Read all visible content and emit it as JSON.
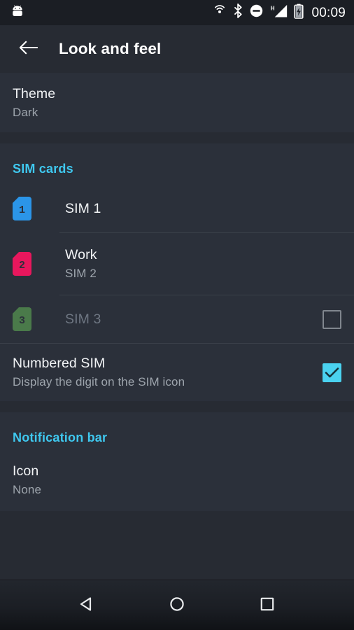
{
  "status_bar": {
    "notification_icon": "android-head-icon",
    "icons": [
      "cast-icon",
      "bluetooth-icon",
      "do-not-disturb-icon",
      "hspa-signal-icon",
      "battery-charging-icon"
    ],
    "clock": "00:09"
  },
  "app_bar": {
    "back_icon": "back-arrow-icon",
    "title": "Look and feel"
  },
  "theme": {
    "title": "Theme",
    "value": "Dark"
  },
  "sim_section": {
    "header": "SIM cards",
    "items": [
      {
        "title": "SIM 1",
        "subtitle": "",
        "digit": "1",
        "color": "#2b95e8",
        "disabled": false,
        "has_checkbox": false,
        "checked": false
      },
      {
        "title": "Work",
        "subtitle": "SIM 2",
        "digit": "2",
        "color": "#e8175d",
        "disabled": false,
        "has_checkbox": false,
        "checked": false
      },
      {
        "title": "SIM 3",
        "subtitle": "",
        "digit": "3",
        "color": "#4a7a4a",
        "disabled": true,
        "has_checkbox": true,
        "checked": false
      }
    ]
  },
  "numbered_sim": {
    "title": "Numbered SIM",
    "subtitle": "Display the digit on the SIM icon",
    "checked": true
  },
  "notification_section": {
    "header": "Notification bar",
    "icon_pref": {
      "title": "Icon",
      "value": "None"
    }
  },
  "nav_bar": {
    "back": "nav-back-icon",
    "home": "nav-home-icon",
    "recents": "nav-recents-icon"
  },
  "colors": {
    "accent": "#3fc8ef",
    "checkbox_checked": "#4ad2f0",
    "background": "#2b303a",
    "app_bar": "#272b33",
    "status_bar": "#1b1e24"
  }
}
